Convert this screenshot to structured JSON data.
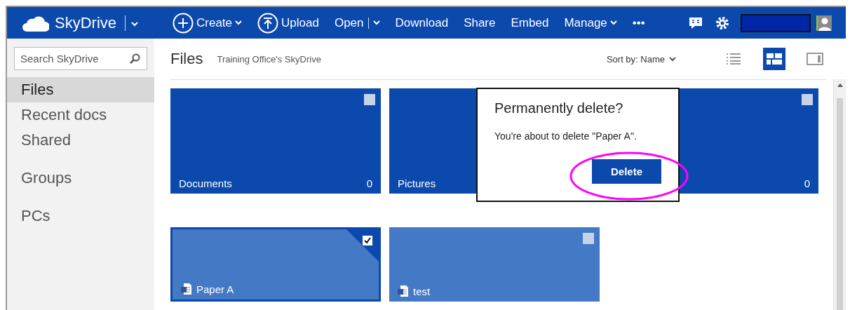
{
  "topbar": {
    "brand": "SkyDrive",
    "actions": [
      {
        "kind": "plus",
        "label": "Create",
        "dropdown": true
      },
      {
        "kind": "upload",
        "label": "Upload",
        "dropdown": false
      },
      {
        "kind": "split",
        "label": "Open",
        "dropdown": true
      },
      {
        "kind": "plain",
        "label": "Download",
        "dropdown": false
      },
      {
        "kind": "plain",
        "label": "Share",
        "dropdown": false
      },
      {
        "kind": "plain",
        "label": "Embed",
        "dropdown": false
      },
      {
        "kind": "plain",
        "label": "Manage",
        "dropdown": true
      },
      {
        "kind": "plain",
        "label": "•••",
        "dropdown": false
      }
    ]
  },
  "sidebar": {
    "search_placeholder": "Search SkyDrive",
    "sections": [
      [
        {
          "label": "Files",
          "selected": true
        },
        {
          "label": "Recent docs",
          "selected": false
        },
        {
          "label": "Shared",
          "selected": false
        }
      ],
      [
        {
          "label": "Groups",
          "selected": false
        }
      ],
      [
        {
          "label": "PCs",
          "selected": false
        }
      ]
    ]
  },
  "header": {
    "title": "Files",
    "subtitle": "Training Office's SkyDrive",
    "sort": "Sort by: Name"
  },
  "views": [
    {
      "kind": "list",
      "selected": false
    },
    {
      "kind": "tiles",
      "selected": true
    },
    {
      "kind": "pane",
      "selected": false
    }
  ],
  "folders": [
    {
      "name": "Documents",
      "count": "0",
      "checked": false
    },
    {
      "name": "Pictures"
    },
    {
      "count": "0",
      "checked": false
    }
  ],
  "files": [
    {
      "name": "Paper A",
      "checked": true,
      "selected": true
    },
    {
      "name": "test",
      "checked": false,
      "selected": false
    }
  ],
  "dialog": {
    "title": "Permanently delete?",
    "message": "You're about to delete \"Paper A\".",
    "button": "Delete",
    "highlighted": true
  }
}
